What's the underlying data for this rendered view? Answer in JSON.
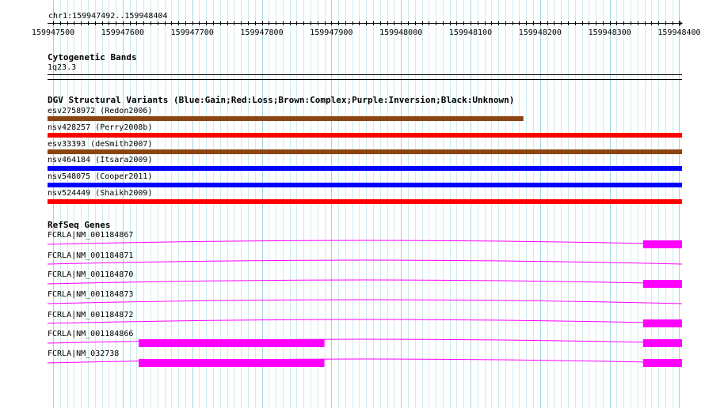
{
  "ruler": {
    "region_label": "chr1:159947492..159948404",
    "start": 159947492,
    "end": 159948404,
    "ticks": [
      "159947500",
      "159947600",
      "159947700",
      "159947800",
      "159947900",
      "159948000",
      "159948100",
      "159948200",
      "159948300",
      "159948400"
    ]
  },
  "cytobands": {
    "title": "Cytogenetic Bands",
    "band": "1q23.3"
  },
  "dgv": {
    "title": "DGV Structural Variants (Blue:Gain;Red:Loss;Brown:Complex;Purple:Inversion;Black:Unknown)",
    "colors": {
      "Gain": "#0000ff",
      "Loss": "#ff0000",
      "Complex": "#8b4513",
      "Inversion": "#800080",
      "Unknown": "#000000"
    },
    "variants": [
      {
        "label": "esv2758972 (Redon2006)",
        "type": "Complex",
        "start": 159947492,
        "end": 159948176
      },
      {
        "label": "nsv428257 (Perry2008b)",
        "type": "Loss",
        "start": 159947492,
        "end": 159948404
      },
      {
        "label": "esv33393 (deSmith2007)",
        "type": "Complex",
        "start": 159947492,
        "end": 159948404
      },
      {
        "label": "nsv464184 (Itsara2009)",
        "type": "Gain",
        "start": 159947492,
        "end": 159948404
      },
      {
        "label": "nsv548075 (Cooper2011)",
        "type": "Gain",
        "start": 159947492,
        "end": 159948404
      },
      {
        "label": "nsv524449 (Shaikh2009)",
        "type": "Loss",
        "start": 159947492,
        "end": 159948404
      }
    ]
  },
  "refseq": {
    "title": "RefSeq Genes",
    "color": "#ff00ff",
    "transcripts": [
      {
        "label": "FCRLA|NM_001184867",
        "exons": [
          [
            159948348,
            159948404
          ]
        ]
      },
      {
        "label": "FCRLA|NM_001184871",
        "exons": []
      },
      {
        "label": "FCRLA|NM_001184870",
        "exons": [
          [
            159948348,
            159948404
          ]
        ]
      },
      {
        "label": "FCRLA|NM_001184873",
        "exons": []
      },
      {
        "label": "FCRLA|NM_001184872",
        "exons": [
          [
            159948348,
            159948404
          ]
        ]
      },
      {
        "label": "FCRLA|NM_001184866",
        "exons": [
          [
            159947623,
            159947890
          ],
          [
            159948348,
            159948404
          ]
        ]
      },
      {
        "label": "FCRLA|NM_032738",
        "exons": [
          [
            159947623,
            159947890
          ],
          [
            159948348,
            159948404
          ]
        ]
      }
    ]
  }
}
